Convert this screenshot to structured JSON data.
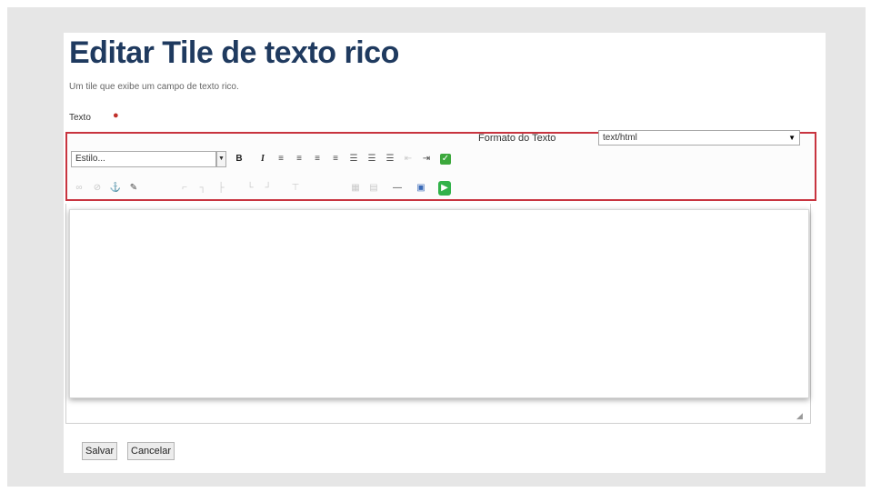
{
  "page": {
    "title": "Editar Tile de texto rico",
    "subtitle": "Um tile que exibe um campo de texto rico."
  },
  "form": {
    "field_label": "Texto",
    "required_marker": "●",
    "format_label": "Formato do Texto",
    "format_value": "text/html",
    "style_value": "Estilo..."
  },
  "toolbar": {
    "row1": [
      {
        "name": "bold-icon",
        "glyph": "B"
      },
      {
        "name": "italic-icon",
        "glyph": "I"
      },
      {
        "name": "align-left-icon",
        "glyph": "≡"
      },
      {
        "name": "align-center-icon",
        "glyph": "≡"
      },
      {
        "name": "align-right-icon",
        "glyph": "≡"
      },
      {
        "name": "align-justify-icon",
        "glyph": "≡"
      },
      {
        "name": "bullet-list-icon",
        "glyph": "☰"
      },
      {
        "name": "numbered-list-icon",
        "glyph": "☰"
      },
      {
        "name": "definition-list-icon",
        "glyph": "☰"
      },
      {
        "name": "outdent-icon",
        "glyph": "⇤"
      },
      {
        "name": "indent-icon",
        "glyph": "⇥"
      },
      {
        "name": "spellcheck-icon",
        "glyph": "✓"
      }
    ],
    "row2": [
      {
        "name": "link-icon",
        "glyph": "∞"
      },
      {
        "name": "unlink-icon",
        "glyph": "⊘"
      },
      {
        "name": "anchor-icon",
        "glyph": "⚓"
      },
      {
        "name": "edit-icon",
        "glyph": "✎"
      },
      {
        "name": "table-icon",
        "glyph": "⌐"
      },
      {
        "name": "row-props-icon",
        "glyph": "┐"
      },
      {
        "name": "cell-props-icon",
        "glyph": "├"
      },
      {
        "name": "insert-row-icon",
        "glyph": "└"
      },
      {
        "name": "delete-row-icon",
        "glyph": "┘"
      },
      {
        "name": "insert-col-icon",
        "glyph": "⊤"
      },
      {
        "name": "image-icon",
        "glyph": "▦"
      },
      {
        "name": "media-icon",
        "glyph": "▤"
      },
      {
        "name": "horizontal-rule-icon",
        "glyph": "—"
      },
      {
        "name": "preview-icon",
        "glyph": "▣"
      },
      {
        "name": "fullscreen-icon",
        "glyph": "▶"
      }
    ]
  },
  "buttons": {
    "save": "Salvar",
    "cancel": "Cancelar"
  },
  "colors": {
    "title": "#1f3a5f",
    "highlight_border": "#c8343f",
    "required": "#c0302b"
  }
}
